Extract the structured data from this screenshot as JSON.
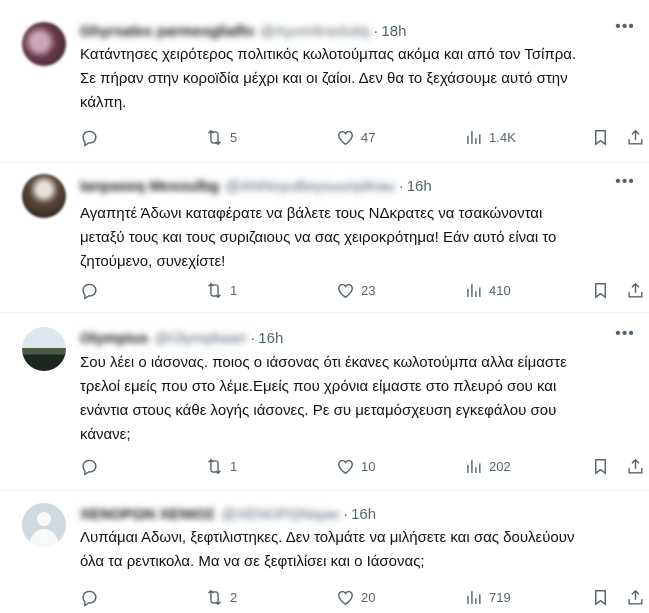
{
  "tweets": [
    {
      "display_name": "Ghyrsales parmesgliaflo",
      "handle": "@Ayomitraxlutiq",
      "time": "18h",
      "text": "Κατάντησες χειρότερος πολιτικός κωλοτούμπας ακόμα και από τον Τσίπρα.\nΣε πήραν στην κοροϊδία μέχρι και οι ζαίοι. Δεν θα το ξεχάσουμε αυτό στην\nκάλπη.",
      "replies": "",
      "retweets": "5",
      "likes": "47",
      "views": "1.4K"
    },
    {
      "display_name": "Ianpaseq Mesoulbg",
      "handle": "@ANNoyuBeysuunpilnau",
      "time": "16h",
      "text": "Αγαπητέ Άδωνι καταφέρατε να βάλετε τους ΝΔκρατες  να τσακώνονται\nμεταξύ τους και τους συριζαιους να σας χειροκρότημα! Εάν αυτό είναι το\nζητούμενο, συνεχίστε!",
      "replies": "",
      "retweets": "1",
      "likes": "23",
      "views": "410"
    },
    {
      "display_name": "Olympius",
      "handle": "@Olympbaari",
      "time": "16h",
      "text": "Σου λέει ο ιάσονας. ποιος ο ιάσονας ότι έκανες κωλοτούμπα αλλα είμαστε\nτρελοί εμείς που στο λέμε.Εμείς που χρόνια είμαστε στο πλευρό σου και\nενάντια στους κάθε λογής ιάσονες. Ρε συ μεταμόσχευση εγκεφάλου σου\nκάνανε;",
      "replies": "",
      "retweets": "1",
      "likes": "10",
      "views": "202"
    },
    {
      "display_name": "ΧΕΝΟΡΩΝ ΧΕΝΙΟΣ",
      "handle": "@ΧΕΝΟΡΩΝαρκι",
      "time": "16h",
      "text": "Λυπάμαι Αδωνι, ξεφτιλιστηκες. Δεν τολμάτε να μιλήσετε και σας δουλεύουν\nόλα τα ρεντικολα. Μα να σε ξεφτιλίσει και ο Ιάσονας;",
      "replies": "",
      "retweets": "2",
      "likes": "20",
      "views": "719"
    }
  ]
}
